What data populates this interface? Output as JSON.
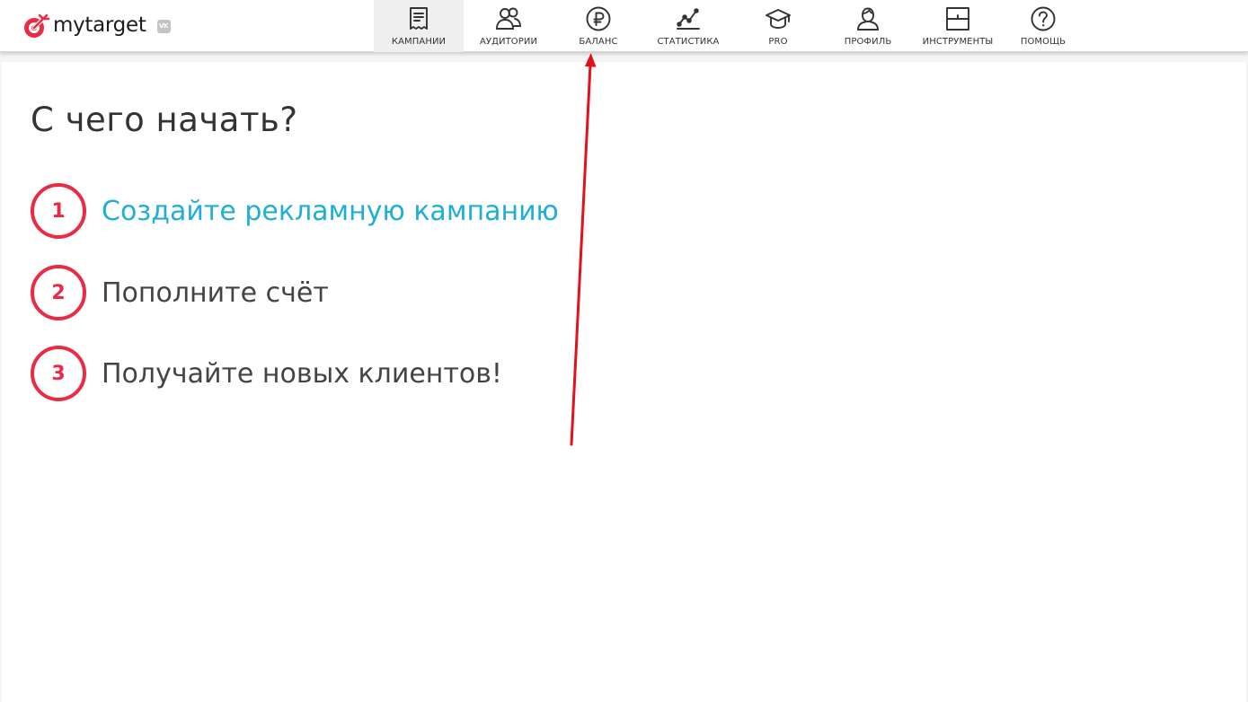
{
  "header": {
    "logo_text": "mytarget",
    "vk_badge": "VK"
  },
  "nav": {
    "items": [
      {
        "label": "КАМПАНИИ",
        "icon": "campaigns-icon",
        "active": true
      },
      {
        "label": "АУДИТОРИИ",
        "icon": "audiences-icon",
        "active": false
      },
      {
        "label": "БАЛАНС",
        "icon": "ruble-icon",
        "active": false
      },
      {
        "label": "СТАТИСТИКА",
        "icon": "statistics-icon",
        "active": false
      },
      {
        "label": "PRO",
        "icon": "graduation-cap-icon",
        "active": false
      },
      {
        "label": "ПРОФИЛЬ",
        "icon": "profile-icon",
        "active": false
      },
      {
        "label": "ИНСТРУМЕНТЫ",
        "icon": "tools-icon",
        "active": false
      },
      {
        "label": "ПОМОЩЬ",
        "icon": "help-icon",
        "active": false
      }
    ]
  },
  "main": {
    "title": "С чего начать?",
    "steps": [
      {
        "number": "1",
        "text": "Создайте рекламную кампанию",
        "is_link": true
      },
      {
        "number": "2",
        "text": "Пополните счёт",
        "is_link": false
      },
      {
        "number": "3",
        "text": "Получайте новых клиентов!",
        "is_link": false
      }
    ]
  },
  "colors": {
    "brand_red": "#ea2b45",
    "link_blue": "#1eaedc",
    "annotation_arrow": "#e3111c",
    "text_dark": "#333333"
  }
}
